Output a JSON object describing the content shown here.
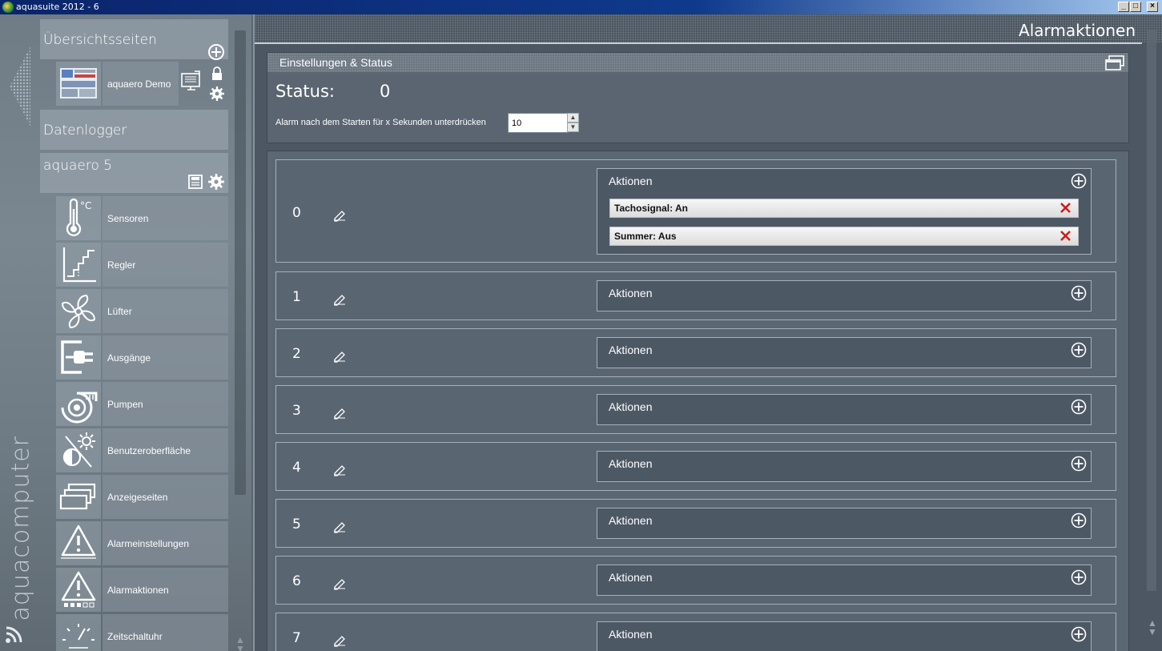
{
  "window": {
    "title": "aquasuite 2012 - 6"
  },
  "brand": {
    "name": "aquacomputer"
  },
  "sidebar": {
    "overview_title": "Übersichtsseiten",
    "overview_item": {
      "label": "aquaero Demo",
      "icons": [
        "monitor-icon",
        "lock-icon",
        "gear-icon"
      ]
    },
    "datalogger_title": "Datenlogger",
    "device_title": "aquaero 5",
    "items": [
      {
        "label": "Sensoren",
        "icon": "thermometer-icon"
      },
      {
        "label": "Regler",
        "icon": "controller-curve-icon"
      },
      {
        "label": "Lüfter",
        "icon": "fan-icon"
      },
      {
        "label": "Ausgänge",
        "icon": "plug-icon"
      },
      {
        "label": "Pumpen",
        "icon": "pump-icon"
      },
      {
        "label": "Benutzeroberfläche",
        "icon": "brightness-icon"
      },
      {
        "label": "Anzeigeseiten",
        "icon": "pages-icon"
      },
      {
        "label": "Alarmeinstellungen",
        "icon": "alarm-warning-icon"
      },
      {
        "label": "Alarmaktionen",
        "icon": "alarm-actions-icon"
      },
      {
        "label": "Zeitschaltuhr",
        "icon": "timer-icon"
      }
    ],
    "thermometer_unit": "°C"
  },
  "main": {
    "page_title": "Alarmaktionen",
    "settings": {
      "section_title": "Einstellungen & Status",
      "status_label": "Status:",
      "status_value": "0",
      "suppress_label": "Alarm nach dem Starten für x Sekunden unterdrücken",
      "suppress_value": "10"
    },
    "actions_label": "Aktionen",
    "alarms": [
      {
        "id": "0",
        "actions": [
          "Tachosignal: An",
          "Summer: Aus"
        ]
      },
      {
        "id": "1",
        "actions": []
      },
      {
        "id": "2",
        "actions": []
      },
      {
        "id": "3",
        "actions": []
      },
      {
        "id": "4",
        "actions": []
      },
      {
        "id": "5",
        "actions": []
      },
      {
        "id": "6",
        "actions": []
      },
      {
        "id": "7",
        "actions": []
      }
    ]
  }
}
